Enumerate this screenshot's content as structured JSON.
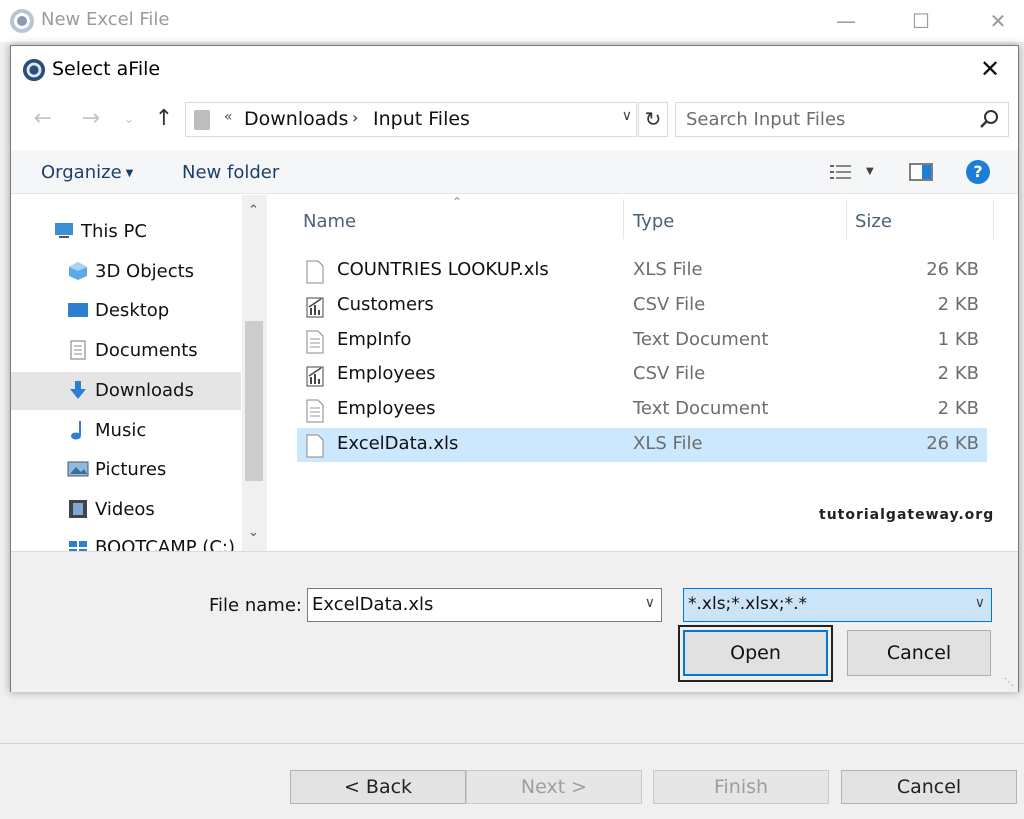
{
  "parent_window": {
    "title": "New Excel File",
    "buttons": {
      "back": "< Back",
      "next": "Next >",
      "finish": "Finish",
      "cancel": "Cancel"
    }
  },
  "dialog": {
    "title": "Select aFile",
    "address": {
      "overflow": "«",
      "crumbs": [
        "Downloads",
        "Input Files"
      ]
    },
    "search_placeholder": "Search Input Files",
    "toolbar": {
      "organize": "Organize",
      "new_folder": "New folder"
    },
    "nav_items": [
      {
        "label": "This PC",
        "icon": "computer-icon"
      },
      {
        "label": "3D Objects",
        "icon": "cube-icon"
      },
      {
        "label": "Desktop",
        "icon": "desktop-icon"
      },
      {
        "label": "Documents",
        "icon": "documents-icon"
      },
      {
        "label": "Downloads",
        "icon": "download-arrow-icon",
        "selected": true
      },
      {
        "label": "Music",
        "icon": "music-note-icon"
      },
      {
        "label": "Pictures",
        "icon": "pictures-icon"
      },
      {
        "label": "Videos",
        "icon": "film-icon"
      },
      {
        "label": "BOOTCAMP (C:)",
        "icon": "drive-icon"
      }
    ],
    "columns": {
      "name": "Name",
      "type": "Type",
      "size": "Size"
    },
    "files": [
      {
        "name": "COUNTRIES LOOKUP.xls",
        "type": "XLS File",
        "size": "26 KB",
        "icon": "blank-file-icon"
      },
      {
        "name": "Customers",
        "type": "CSV File",
        "size": "2 KB",
        "icon": "csv-file-icon"
      },
      {
        "name": "EmpInfo",
        "type": "Text Document",
        "size": "1 KB",
        "icon": "text-file-icon"
      },
      {
        "name": "Employees",
        "type": "CSV File",
        "size": "2 KB",
        "icon": "csv-file-icon"
      },
      {
        "name": "Employees",
        "type": "Text Document",
        "size": "2 KB",
        "icon": "text-file-icon"
      },
      {
        "name": "ExcelData.xls",
        "type": "XLS File",
        "size": "26 KB",
        "icon": "blank-file-icon",
        "selected": true
      }
    ],
    "watermark": "tutorialgateway.org",
    "file_name_label": "File name:",
    "file_name_value": "ExcelData.xls",
    "filter_value": "*.xls;*.xlsx;*.*",
    "open_label": "Open",
    "cancel_label": "Cancel"
  },
  "colors": {
    "accent": "#0078d7",
    "selection": "#cce8ff",
    "nav_selected": "#e5e5e5",
    "header_text": "#4c607a"
  }
}
